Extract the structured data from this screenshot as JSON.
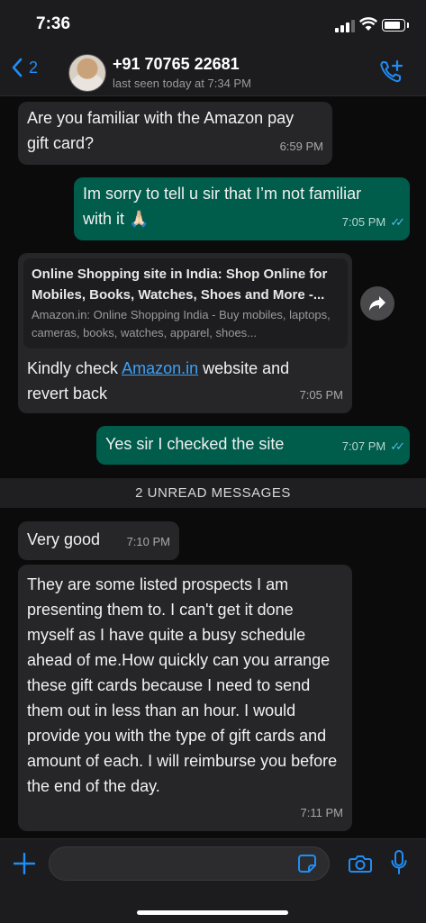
{
  "status_bar": {
    "time": "7:36"
  },
  "header": {
    "back_count": "2",
    "contact_name": "+91 70765 22681",
    "last_seen": "last seen today at 7:34 PM"
  },
  "messages": [
    {
      "direction": "incoming",
      "text": "Are you familiar with the Amazon pay gift card?",
      "time": "6:59 PM"
    },
    {
      "direction": "outgoing",
      "text": "Im sorry to tell u sir that I’m not familiar with it 🙏🏻",
      "time": "7:05 PM",
      "status": "read"
    },
    {
      "direction": "incoming",
      "link_preview": {
        "title": "Online Shopping site in India: Shop Online for Mobiles, Books, Watches, Shoes and More -...",
        "description": "Amazon.in: Online Shopping India - Buy mobiles, laptops, cameras, books, watches, apparel, shoes..."
      },
      "text_before": "Kindly check ",
      "link_text": "Amazon.in",
      "text_after": " website and revert back",
      "time": "7:05 PM"
    },
    {
      "direction": "outgoing",
      "text": "Yes sir I checked the site",
      "time": "7:07 PM",
      "status": "read"
    }
  ],
  "unread_divider": "2 UNREAD MESSAGES",
  "unread_messages": [
    {
      "direction": "incoming",
      "text": "Very good",
      "time": "7:10 PM"
    },
    {
      "direction": "incoming",
      "text": "They are some listed prospects I am presenting them to. I can't get it done myself as I have quite a busy schedule ahead of me.How quickly can you arrange these gift cards because I need to send them out in less than an hour. I would provide you with the type of gift cards and amount of each. I will reimburse you before the end of the day.",
      "time": "7:11 PM"
    }
  ],
  "composer": {
    "input_value": ""
  },
  "colors": {
    "accent": "#1f8df7",
    "outgoing_bubble": "#005c4b",
    "incoming_bubble": "#262628",
    "read_ticks": "#53bdeb"
  },
  "icons": [
    "chevron-left-icon",
    "call-add-icon",
    "forward-icon",
    "plus-icon",
    "sticker-icon",
    "camera-icon",
    "mic-icon"
  ]
}
